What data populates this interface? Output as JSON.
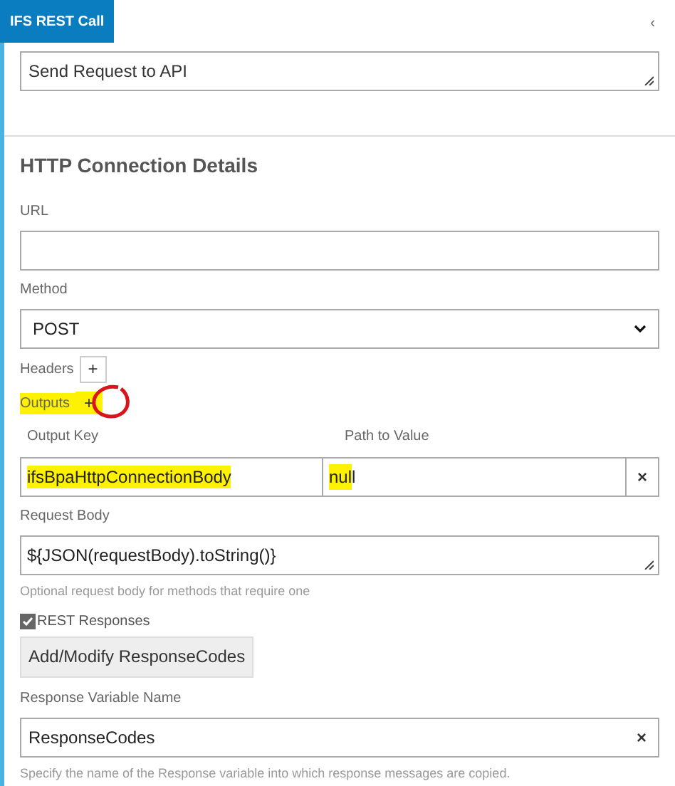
{
  "panel": {
    "title": "IFS REST Call",
    "collapse_icon": "‹",
    "name_value": "Send Request to API"
  },
  "section": {
    "heading": "HTTP Connection Details"
  },
  "url": {
    "label": "URL"
  },
  "method": {
    "label": "Method",
    "value": "POST"
  },
  "headers": {
    "label": "Headers",
    "add": "+"
  },
  "outputs": {
    "label": "Outputs",
    "add": "+",
    "highlighted": true,
    "circled": true
  },
  "output_columns": [
    "Output Key",
    "Path to Value"
  ],
  "output_rows": [
    {
      "key": "ifsBpaHttpConnectionBody",
      "key_highlighted": true,
      "path_highlight": "nul",
      "path_rest": "l",
      "remove": "×"
    }
  ],
  "request_body": {
    "label": "Request Body",
    "value": "${JSON(requestBody).toString()}",
    "hint": "Optional request body for methods that require one"
  },
  "rest_responses": {
    "label": "REST Responses",
    "checked": true
  },
  "modify_button": "Add/Modify ResponseCodes",
  "response_variable": {
    "label": "Response Variable Name",
    "value": "ResponseCodes",
    "clear": "×",
    "hint": "Specify the name of the Response variable into which response messages are copied."
  }
}
